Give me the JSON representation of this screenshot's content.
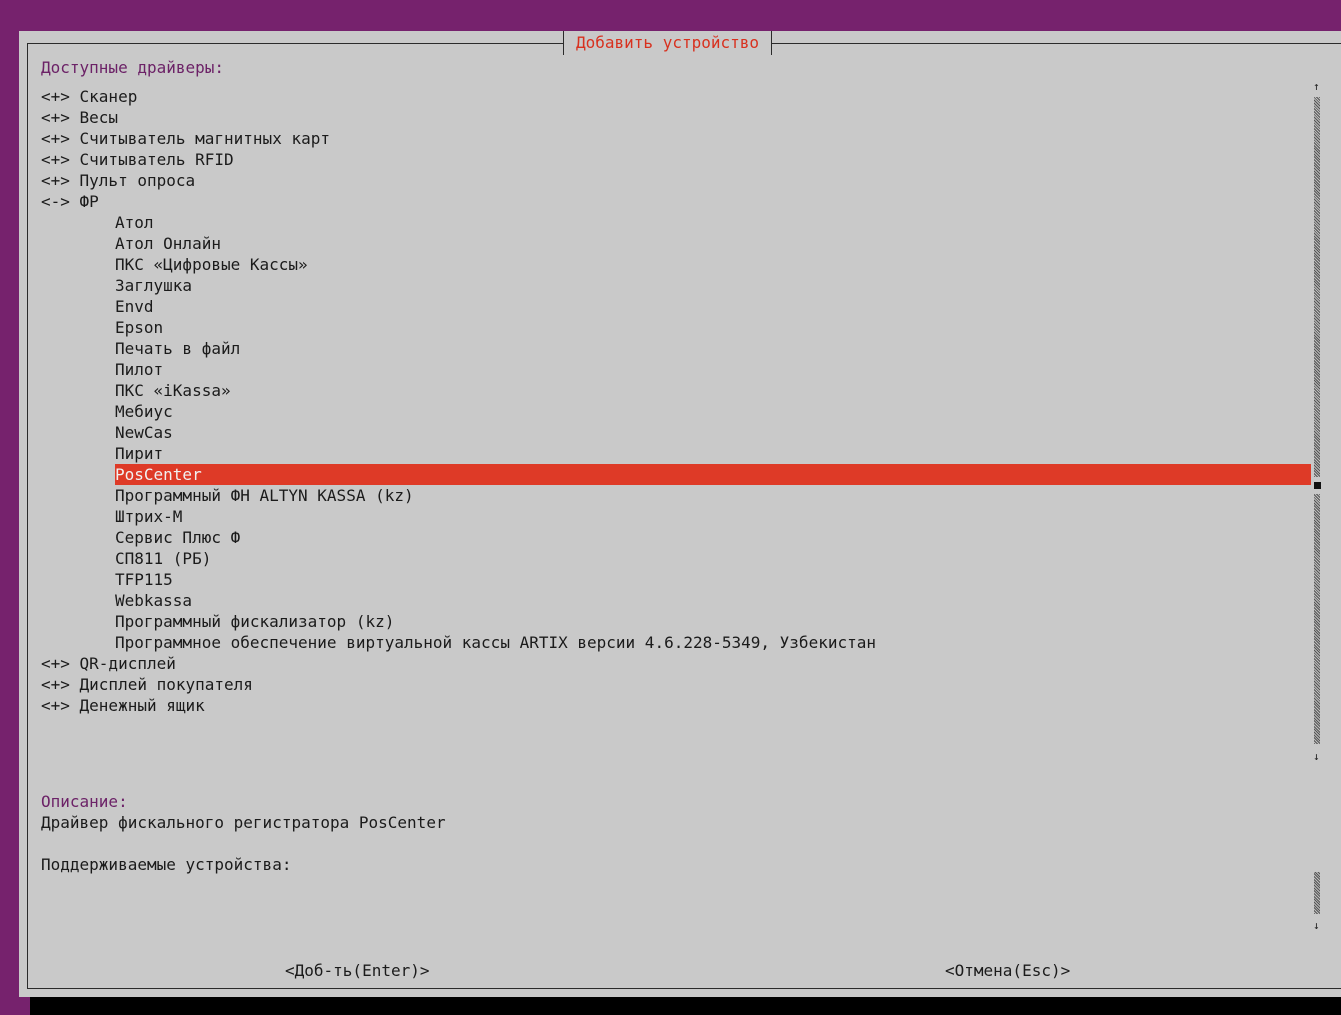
{
  "dialog": {
    "title": "Добавить устройство",
    "drivers_label": "Доступные драйверы:",
    "items": [
      {
        "text": "<+> Сканер",
        "level": 0
      },
      {
        "text": "<+> Весы",
        "level": 0
      },
      {
        "text": "<+> Считыватель магнитных карт",
        "level": 0
      },
      {
        "text": "<+> Считыватель RFID",
        "level": 0
      },
      {
        "text": "<+> Пульт опроса",
        "level": 0
      },
      {
        "text": "<-> ФР",
        "level": 0
      },
      {
        "text": "Атол",
        "level": 1
      },
      {
        "text": "Атол Онлайн",
        "level": 1
      },
      {
        "text": "ПКС «Цифровые Кассы»",
        "level": 1
      },
      {
        "text": "Заглушка",
        "level": 1
      },
      {
        "text": "Envd",
        "level": 1
      },
      {
        "text": "Epson",
        "level": 1
      },
      {
        "text": "Печать в файл",
        "level": 1
      },
      {
        "text": "Пилот",
        "level": 1
      },
      {
        "text": "ПКС «iKassa»",
        "level": 1
      },
      {
        "text": "Мебиус",
        "level": 1
      },
      {
        "text": "NewCas",
        "level": 1
      },
      {
        "text": "Пирит",
        "level": 1
      },
      {
        "text": "PosCenter",
        "level": 1,
        "selected": true
      },
      {
        "text": "Программный ФН ALTYN KASSA (kz)",
        "level": 1
      },
      {
        "text": "Штрих-М",
        "level": 1
      },
      {
        "text": "Сервис Плюс Ф",
        "level": 1
      },
      {
        "text": "СП811 (РБ)",
        "level": 1
      },
      {
        "text": "TFP115",
        "level": 1
      },
      {
        "text": "Webkassa",
        "level": 1
      },
      {
        "text": "Программный фискализатор (kz)",
        "level": 1
      },
      {
        "text": "Программное обеспечение виртуальной кассы ARTIX версии 4.6.228-5349, Узбекистан",
        "level": 1
      },
      {
        "text": "<+> QR-дисплей",
        "level": 0
      },
      {
        "text": "<+> Дисплей покупателя",
        "level": 0
      },
      {
        "text": "<+> Денежный ящик",
        "level": 0
      }
    ],
    "description_label": "Описание:",
    "description_text": "Драйвер фискального регистратора PosCenter",
    "supported_label": "Поддерживаемые устройства:",
    "add_button": "<Доб-ть(Enter)>",
    "cancel_button": "<Отмена(Esc)>",
    "scroll_up_arrow": "↑",
    "scroll_down_arrow": "↓"
  },
  "colors": {
    "background": "#76226d",
    "dialog": "#c9c9c9",
    "accent": "#d8311f",
    "selection": "#de3a27",
    "label": "#6c2267"
  }
}
